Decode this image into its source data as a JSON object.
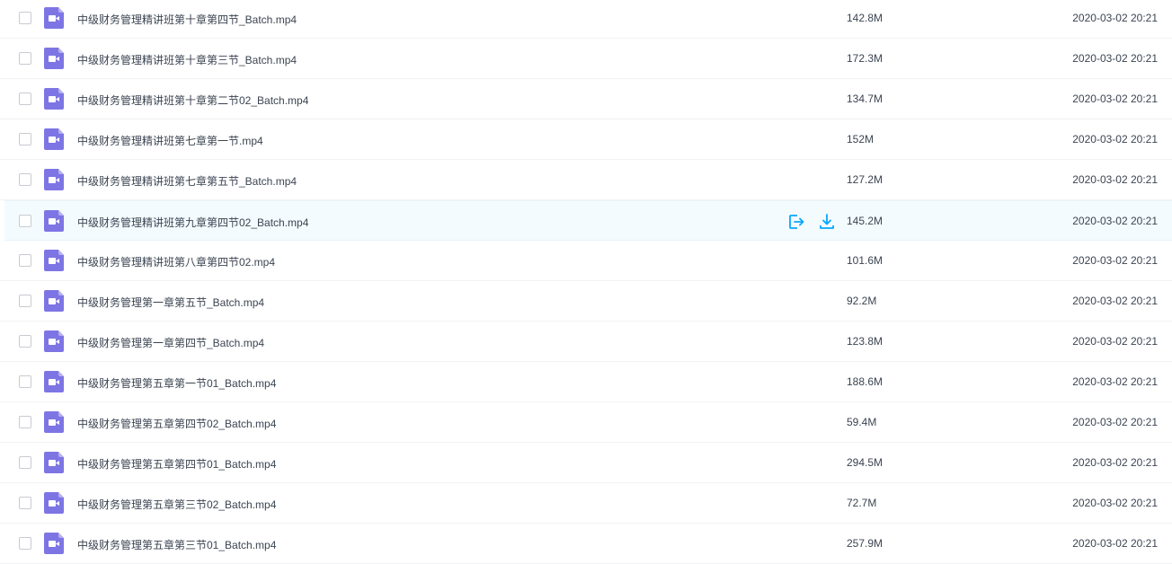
{
  "colors": {
    "accent": "#06a7ff",
    "video_icon": "#7e75e4",
    "hover_row": "#f4fbfe"
  },
  "row_actions": {
    "move_icon": "move-out-icon",
    "download_icon": "download-icon"
  },
  "files": [
    {
      "name": "中级财务管理精讲班第十章第四节_Batch.mp4",
      "size": "142.8M",
      "date": "2020-03-02 20:21",
      "icon": "video-file-icon"
    },
    {
      "name": "中级财务管理精讲班第十章第三节_Batch.mp4",
      "size": "172.3M",
      "date": "2020-03-02 20:21",
      "icon": "video-file-icon"
    },
    {
      "name": "中级财务管理精讲班第十章第二节02_Batch.mp4",
      "size": "134.7M",
      "date": "2020-03-02 20:21",
      "icon": "video-file-icon"
    },
    {
      "name": "中级财务管理精讲班第七章第一节.mp4",
      "size": "152M",
      "date": "2020-03-02 20:21",
      "icon": "video-file-icon"
    },
    {
      "name": "中级财务管理精讲班第七章第五节_Batch.mp4",
      "size": "127.2M",
      "date": "2020-03-02 20:21",
      "icon": "video-file-icon"
    },
    {
      "name": "中级财务管理精讲班第九章第四节02_Batch.mp4",
      "size": "145.2M",
      "date": "2020-03-02 20:21",
      "icon": "video-file-icon",
      "hovered": true
    },
    {
      "name": "中级财务管理精讲班第八章第四节02.mp4",
      "size": "101.6M",
      "date": "2020-03-02 20:21",
      "icon": "video-file-icon"
    },
    {
      "name": "中级财务管理第一章第五节_Batch.mp4",
      "size": "92.2M",
      "date": "2020-03-02 20:21",
      "icon": "video-file-icon"
    },
    {
      "name": "中级财务管理第一章第四节_Batch.mp4",
      "size": "123.8M",
      "date": "2020-03-02 20:21",
      "icon": "video-file-icon"
    },
    {
      "name": "中级财务管理第五章第一节01_Batch.mp4",
      "size": "188.6M",
      "date": "2020-03-02 20:21",
      "icon": "video-file-icon"
    },
    {
      "name": "中级财务管理第五章第四节02_Batch.mp4",
      "size": "59.4M",
      "date": "2020-03-02 20:21",
      "icon": "video-file-icon"
    },
    {
      "name": "中级财务管理第五章第四节01_Batch.mp4",
      "size": "294.5M",
      "date": "2020-03-02 20:21",
      "icon": "video-file-icon"
    },
    {
      "name": "中级财务管理第五章第三节02_Batch.mp4",
      "size": "72.7M",
      "date": "2020-03-02 20:21",
      "icon": "video-file-icon"
    },
    {
      "name": "中级财务管理第五章第三节01_Batch.mp4",
      "size": "257.9M",
      "date": "2020-03-02 20:21",
      "icon": "video-file-icon"
    }
  ]
}
